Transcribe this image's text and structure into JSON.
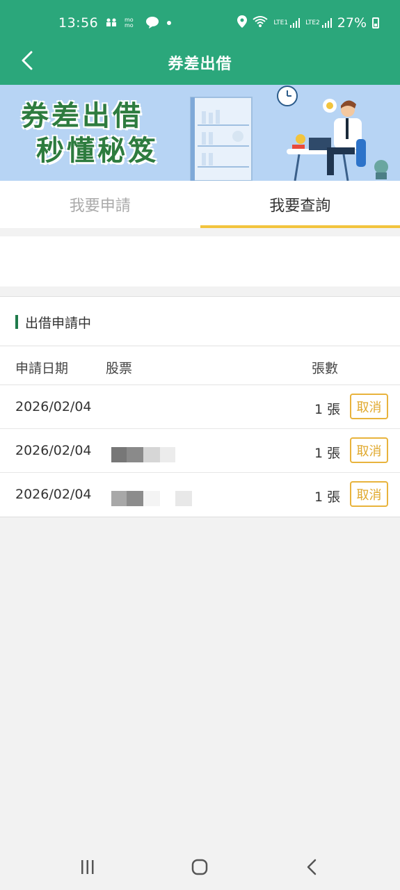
{
  "status_bar": {
    "time": "13:56",
    "battery_text": "27%",
    "lte1": "LTE1",
    "lte2": "LTE2"
  },
  "header": {
    "title": "券差出借"
  },
  "banner": {
    "line1": "券差出借",
    "line2": "秒懂秘笈"
  },
  "tabs": [
    {
      "label": "我要申請",
      "active": false
    },
    {
      "label": "我要查詢",
      "active": true
    }
  ],
  "section": {
    "title": "出借申請中",
    "accent_color": "#1f7a4b"
  },
  "table": {
    "headers": {
      "date": "申請日期",
      "stock": "股票",
      "qty": "張數"
    },
    "rows": [
      {
        "date": "2026/02/04",
        "qty": "1 張",
        "action": "取消"
      },
      {
        "date": "2026/02/04",
        "qty": "1 張",
        "action": "取消"
      },
      {
        "date": "2026/02/04",
        "qty": "1 張",
        "action": "取消"
      }
    ]
  },
  "colors": {
    "brand_green": "#2ba77b",
    "tab_indicator": "#f2c43d",
    "cancel_border": "#e8b33c"
  }
}
